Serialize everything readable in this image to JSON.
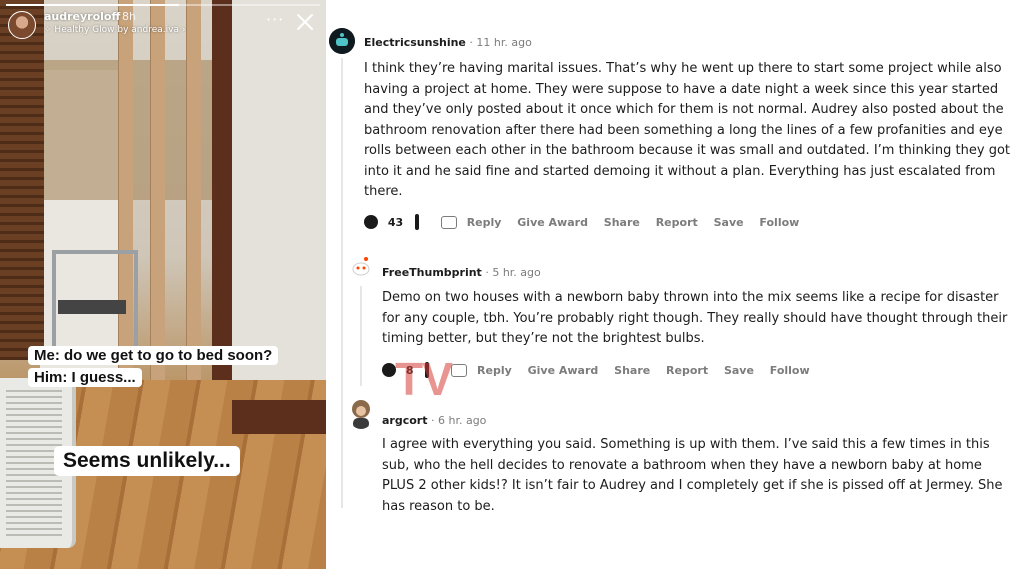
{
  "story": {
    "username": "audreyroloff",
    "time_ago": "8h",
    "music": "Healthy Glow by andrea.iva",
    "caption_1": "Me: do we get to go to bed soon?",
    "caption_2": "Him: I guess...",
    "caption_3": "Seems unlikely...",
    "progress_fraction": 0.55
  },
  "comments": [
    {
      "author": "Electricsunshine",
      "dot": "·",
      "age": "11 hr. ago",
      "body": "I think they’re having marital issues. That’s why he went up there to start some project while also having a project at home. They were suppose to have a date night a week since this year started and they’ve only posted about it once which for them is not normal. Audrey also posted about the bathroom renovation after there had been something a long the lines of a few profanities and eye rolls between each other in the bathroom because it was small and outdated. I’m thinking they got into it and he said fine and started demoing it without a plan. Everything has just escalated from there.",
      "votes": "43",
      "actions": [
        "Reply",
        "Give Award",
        "Share",
        "Report",
        "Save",
        "Follow"
      ]
    },
    {
      "author": "FreeThumbprint",
      "dot": "·",
      "age": "5 hr. ago",
      "body": "Demo on two houses with a newborn baby thrown into the mix seems like a recipe for disaster for any couple, tbh. You’re probably right though. They really should have thought through their timing better, but they’re not the brightest bulbs.",
      "votes": "8",
      "actions": [
        "Reply",
        "Give Award",
        "Share",
        "Report",
        "Save",
        "Follow"
      ]
    },
    {
      "author": "argcort",
      "dot": "·",
      "age": "6 hr. ago",
      "body": "I agree with everything you said. Something is up with them. I’ve said this a few times in this sub, who the hell decides to renovate a bathroom when they have a newborn baby at home PLUS 2 other kids!? It isn’t fair to Audrey and I completely get if she is pissed off at Jermey. She has reason to be."
    }
  ],
  "watermark": "TV",
  "colors": {
    "text": "#1c1c1c",
    "meta": "#7c7c7c",
    "thread_line": "#e6e6e6",
    "watermark": "#d63c34"
  },
  "icons": {
    "upvote": "upvote-icon",
    "downvote": "downvote-icon",
    "reply": "reply-icon",
    "more": "more-icon",
    "close": "close-icon",
    "music": "sparkle-icon"
  }
}
